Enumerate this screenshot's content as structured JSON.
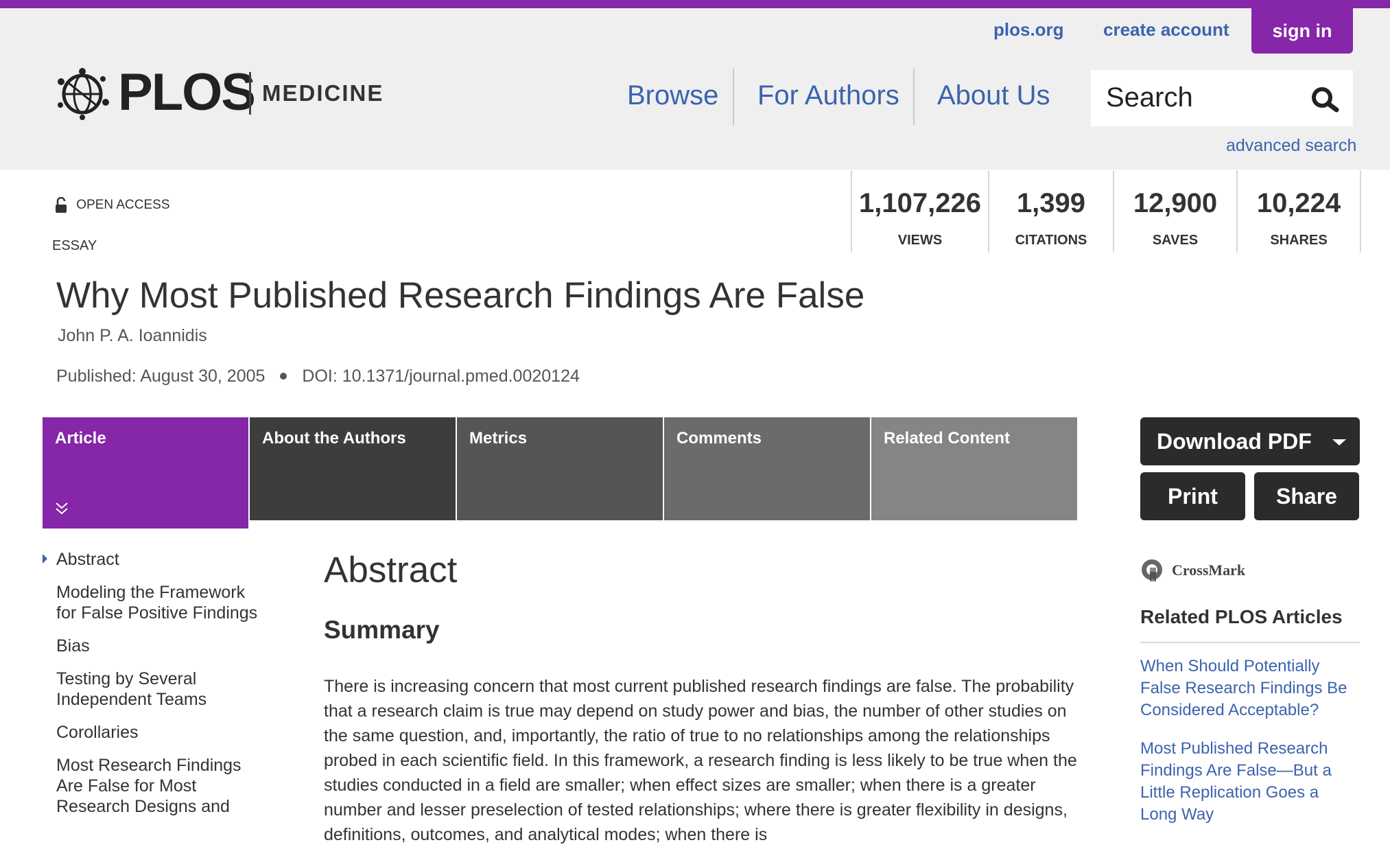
{
  "colors": {
    "brand_purple": "#8626a9",
    "link_blue": "#3c63af",
    "header_bg": "#efefef",
    "dark_button": "#2b2b2b"
  },
  "header": {
    "links": {
      "plos_org": "plos.org",
      "create_account": "create account",
      "sign_in": "sign in"
    },
    "logo": {
      "brand": "PLOS",
      "journal": "MEDICINE"
    },
    "nav": [
      "Browse",
      "For Authors",
      "About Us"
    ],
    "search": {
      "placeholder": "Search",
      "icon": "search-icon",
      "advanced": "advanced search"
    }
  },
  "article": {
    "access": "OPEN ACCESS",
    "type": "ESSAY",
    "title": "Why Most Published Research Findings Are False",
    "author": "John P. A. Ioannidis",
    "published": "Published: August 30, 2005",
    "doi": "DOI: 10.1371/journal.pmed.0020124"
  },
  "metrics": [
    {
      "value": "1,107,226",
      "label": "VIEWS"
    },
    {
      "value": "1,399",
      "label": "CITATIONS"
    },
    {
      "value": "12,900",
      "label": "SAVES"
    },
    {
      "value": "10,224",
      "label": "SHARES"
    }
  ],
  "tabs": [
    {
      "label": "Article",
      "active": true
    },
    {
      "label": "About the Authors"
    },
    {
      "label": "Metrics"
    },
    {
      "label": "Comments"
    },
    {
      "label": "Related Content"
    }
  ],
  "actions": {
    "download_pdf": "Download PDF",
    "print": "Print",
    "share": "Share"
  },
  "toc": [
    "Abstract",
    "Modeling the Framework for False Positive Findings",
    "Bias",
    "Testing by Several Independent Teams",
    "Corollaries",
    "Most Research Findings Are False for Most Research Designs and"
  ],
  "content": {
    "section_title": "Abstract",
    "subsection_title": "Summary",
    "paragraph": "There is increasing concern that most current published research findings are false. The probability that a research claim is true may depend on study power and bias, the number of other studies on the same question, and, importantly, the ratio of true to no relationships among the relationships probed in each scientific field. In this framework, a research finding is less likely to be true when the studies conducted in a field are smaller; when effect sizes are smaller; when there is a greater number and lesser preselection of tested relationships; where there is greater flexibility in designs, definitions, outcomes, and analytical modes; when there is"
  },
  "sidebar": {
    "crossmark": "CrossMark",
    "related_heading": "Related PLOS Articles",
    "related": [
      "When Should Potentially False Research Findings Be Considered Acceptable?",
      "Most Published Research Findings Are False—But a Little Replication Goes a Long Way"
    ]
  }
}
